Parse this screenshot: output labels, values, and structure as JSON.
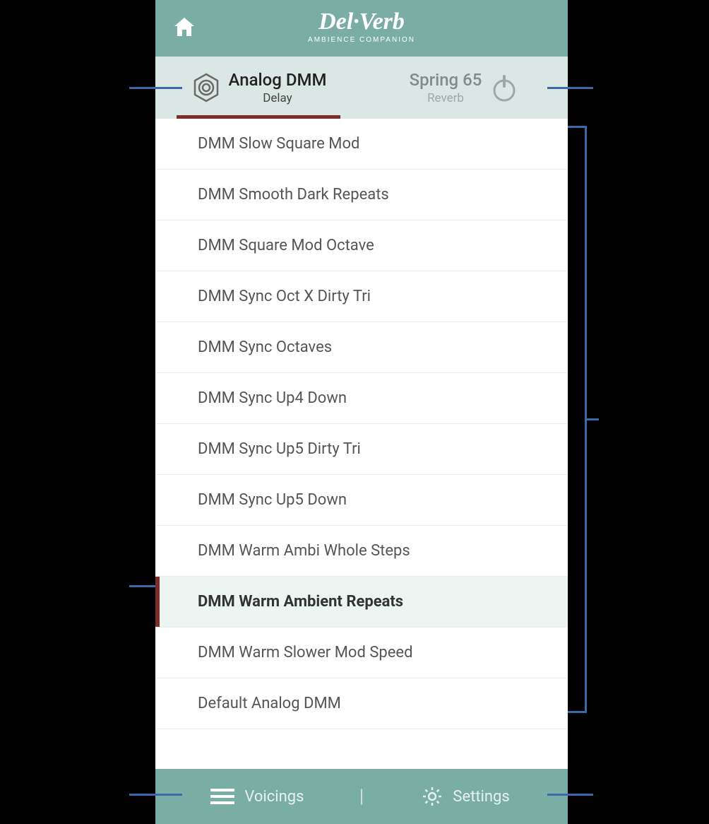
{
  "header": {
    "logo_main": "Del·Verb",
    "logo_sub": "AMBIENCE COMPANION"
  },
  "tabs": {
    "left": {
      "title": "Analog DMM",
      "sub": "Delay"
    },
    "right": {
      "title": "Spring 65",
      "sub": "Reverb"
    }
  },
  "presets": [
    {
      "label": "DMM Slow Square Mod",
      "selected": false
    },
    {
      "label": "DMM Smooth Dark Repeats",
      "selected": false
    },
    {
      "label": "DMM Square Mod Octave",
      "selected": false
    },
    {
      "label": "DMM Sync Oct X Dirty Tri",
      "selected": false
    },
    {
      "label": "DMM Sync Octaves",
      "selected": false
    },
    {
      "label": "DMM Sync Up4 Down",
      "selected": false
    },
    {
      "label": "DMM Sync Up5 Dirty Tri",
      "selected": false
    },
    {
      "label": "DMM Sync Up5 Down",
      "selected": false
    },
    {
      "label": "DMM Warm Ambi Whole Steps",
      "selected": false
    },
    {
      "label": "DMM Warm Ambient Repeats",
      "selected": true
    },
    {
      "label": "DMM Warm Slower Mod Speed",
      "selected": false
    },
    {
      "label": "Default Analog DMM",
      "selected": false
    }
  ],
  "footer": {
    "voicings": "Voicings",
    "settings": "Settings"
  }
}
